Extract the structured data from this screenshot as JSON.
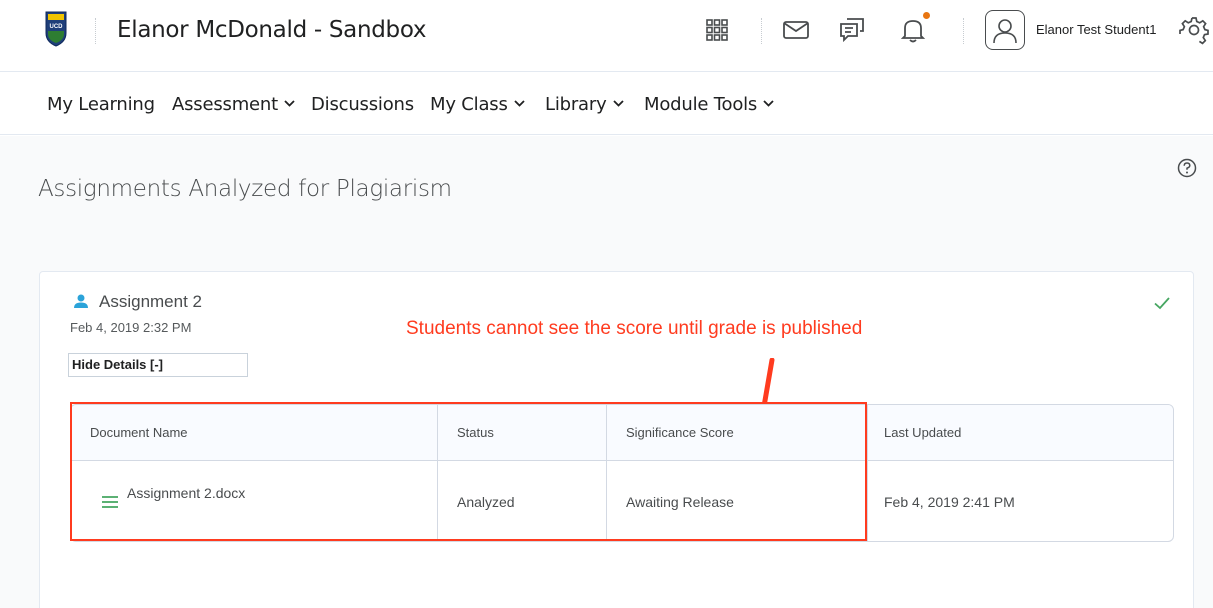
{
  "header": {
    "site_title": "Elanor McDonald - Sandbox",
    "user_name": "Elanor Test Student1",
    "icons": [
      "ucd-logo-icon",
      "apps-grid-icon",
      "mail-icon",
      "chat-icon",
      "bell-icon",
      "avatar-icon",
      "gear-icon"
    ],
    "notification_color": "#e87511"
  },
  "nav": {
    "items": [
      {
        "label": "My Learning",
        "dropdown": false
      },
      {
        "label": "Assessment",
        "dropdown": true
      },
      {
        "label": "Discussions",
        "dropdown": false
      },
      {
        "label": "My Class",
        "dropdown": true
      },
      {
        "label": "Library",
        "dropdown": true
      },
      {
        "label": "Module Tools",
        "dropdown": true
      }
    ]
  },
  "page": {
    "title": "Assignments Analyzed for Plagiarism"
  },
  "assignment": {
    "title": "Assignment 2",
    "date": "Feb 4, 2019 2:32 PM",
    "toggle_label": "Hide Details [-]",
    "accent_color": "#2ba3d9",
    "check_color": "#46a661"
  },
  "table": {
    "headers": [
      "Document Name",
      "Status",
      "Significance Score",
      "Last Updated"
    ],
    "rows": [
      {
        "document": "Assignment 2.docx",
        "status": "Analyzed",
        "score": "Awaiting Release",
        "updated": "Feb 4, 2019 2:41 PM"
      }
    ]
  },
  "annotation": {
    "text": "Students cannot see the score until grade is published",
    "color": "#ff3b1f"
  }
}
